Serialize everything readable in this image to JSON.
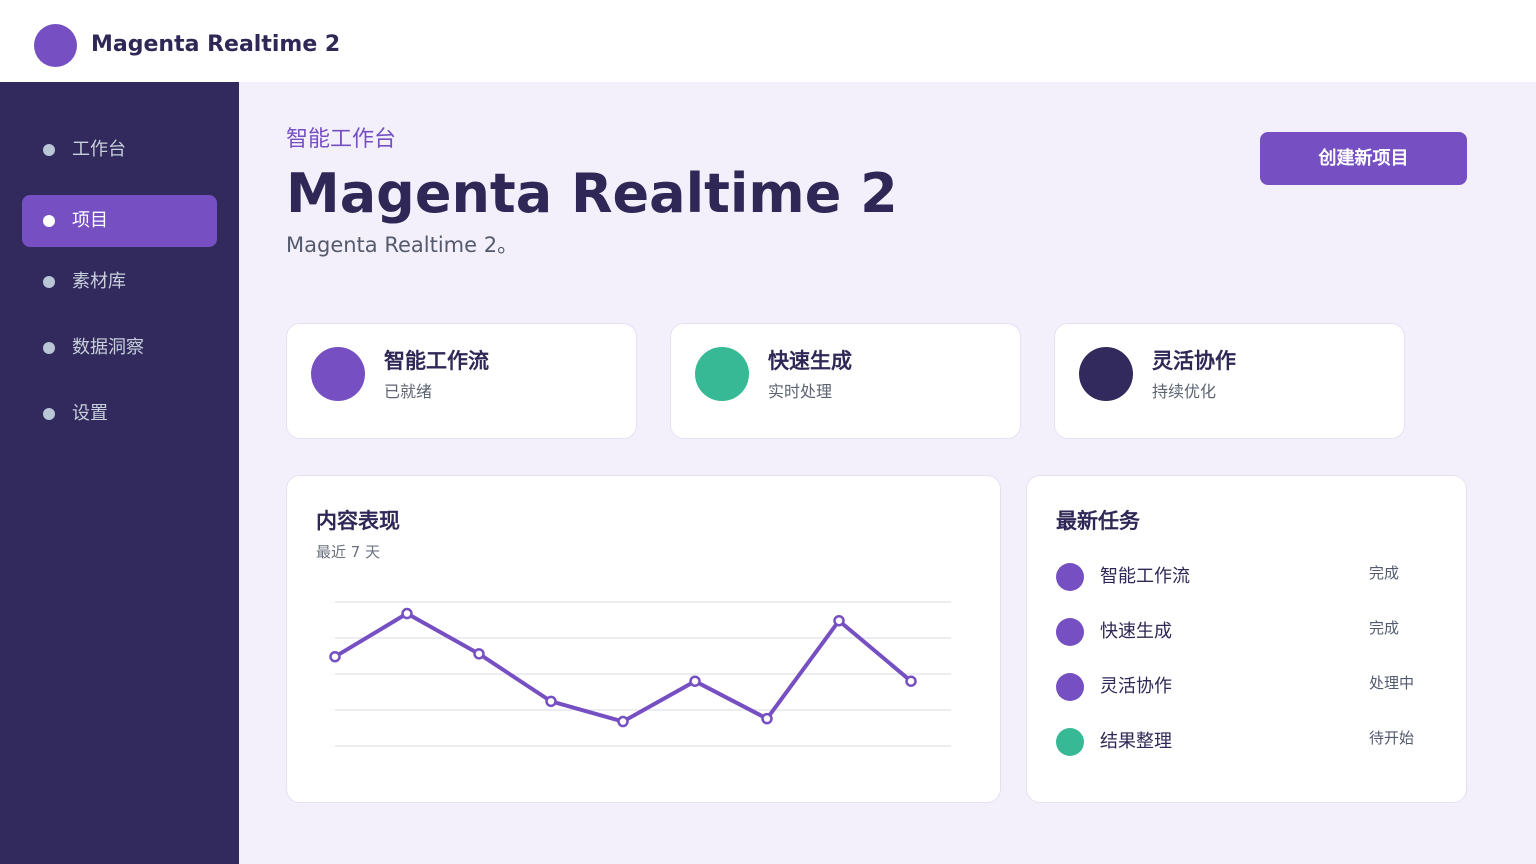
{
  "app": {
    "title": "Magenta Realtime 2"
  },
  "sidebar": {
    "items": [
      {
        "label": "工作台"
      },
      {
        "label": "项目"
      },
      {
        "label": "素材库"
      },
      {
        "label": "数据洞察"
      },
      {
        "label": "设置"
      }
    ],
    "active_index": 1
  },
  "header": {
    "eyebrow": "智能工作台",
    "title": "Magenta Realtime 2",
    "description": "Magenta Realtime 2。",
    "create_button_label": "创建新项目"
  },
  "stats": [
    {
      "title": "智能工作流",
      "subtitle": "已就绪",
      "color": "#7650c2"
    },
    {
      "title": "快速生成",
      "subtitle": "实时处理",
      "color": "#36b994"
    },
    {
      "title": "灵活协作",
      "subtitle": "持续优化",
      "color": "#322a5c"
    }
  ],
  "performance": {
    "title": "内容表现",
    "subtitle": "最近 7 天"
  },
  "chart_data": {
    "type": "line",
    "x": [
      1,
      2,
      3,
      4,
      5,
      6,
      7,
      8,
      9
    ],
    "series": [
      {
        "values": [
          0.62,
          0.92,
          0.64,
          0.31,
          0.17,
          0.45,
          0.19,
          0.87,
          0.45
        ],
        "color": "#7650c2"
      }
    ],
    "ylim": [
      0,
      1
    ],
    "grid": true
  },
  "tasks": {
    "title": "最新任务",
    "items": [
      {
        "name": "智能工作流",
        "status": "完成",
        "color": "#7650c2"
      },
      {
        "name": "快速生成",
        "status": "完成",
        "color": "#7650c2"
      },
      {
        "name": "灵活协作",
        "status": "处理中",
        "color": "#7650c2"
      },
      {
        "name": "结果整理",
        "status": "待开始",
        "color": "#36b994"
      }
    ]
  }
}
